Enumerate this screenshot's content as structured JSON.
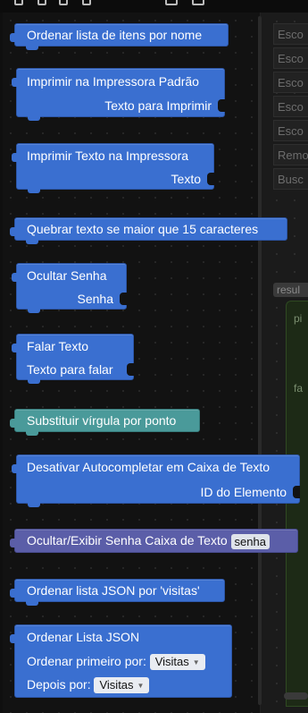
{
  "workspace": {
    "items": [
      "Esco",
      "Esco",
      "Esco",
      "Esco",
      "Esco",
      "Remo",
      "Busc"
    ],
    "result_label": "resul",
    "inner_chars": [
      "pi",
      "fa"
    ]
  },
  "blocks": {
    "b1": "Ordenar lista de itens por nome",
    "b2_line1": "Imprimir na Impressora Padrão",
    "b2_line2": "Texto para Imprimir",
    "b3_line1": "Imprimir Texto na Impressora",
    "b3_line2": "Texto",
    "b4": "Quebrar texto se maior que 15 caracteres",
    "b5_line1": "Ocultar Senha",
    "b5_line2": "Senha",
    "b6_line1": "Falar Texto",
    "b6_line2": "Texto para falar",
    "b7": "Substituir vírgula por ponto",
    "b8_line1": "Desativar Autocompletar em Caixa de Texto",
    "b8_line2": "ID do Elemento",
    "b9_text": "Ocultar/Exibir Senha  Caixa de Texto",
    "b9_value": "senha",
    "b10": "Ordenar lista JSON por 'visitas'",
    "b11_line1": "Ordenar Lista JSON",
    "b11_line2": "Ordenar primeiro por:",
    "b11_dd1": "Visitas",
    "b11_line3": "Depois por:",
    "b11_dd2": "Visitas"
  },
  "colors": {
    "block_blue": "#3a6fd0",
    "block_teal": "#4a9a9a",
    "block_purple": "#5b5ea8",
    "background": "#0f0f0f"
  }
}
